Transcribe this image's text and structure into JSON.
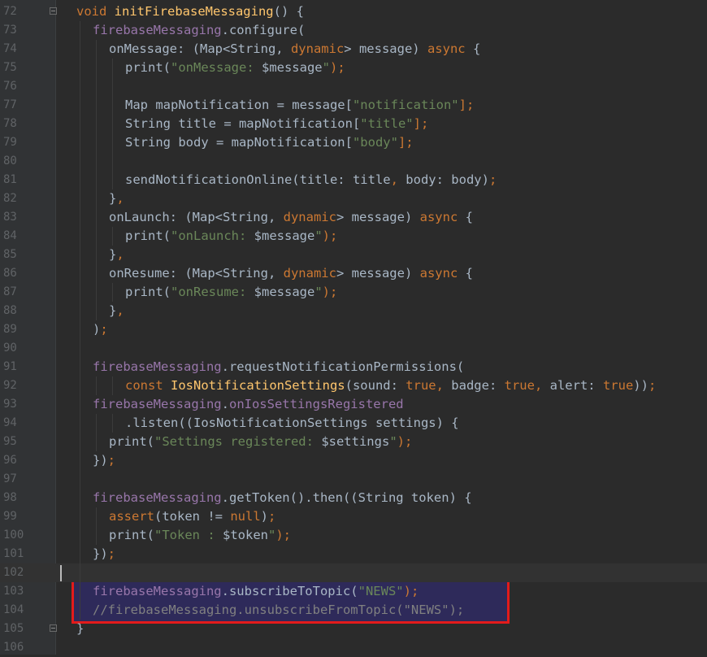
{
  "editor": {
    "lines": [
      {
        "n": "72",
        "fold": true,
        "indent": 0,
        "tokens": [
          {
            "t": "void ",
            "c": "k"
          },
          {
            "t": "initFirebaseMessaging",
            "c": "fn"
          },
          {
            "t": "() {",
            "c": "pl"
          }
        ]
      },
      {
        "n": "73",
        "indent": 1,
        "tokens": [
          {
            "t": "firebaseMessaging",
            "c": "f"
          },
          {
            "t": ".configure(",
            "c": "pl"
          }
        ]
      },
      {
        "n": "74",
        "indent": 2,
        "tokens": [
          {
            "t": "onMessage: (Map<String, ",
            "c": "pl"
          },
          {
            "t": "dynamic",
            "c": "k"
          },
          {
            "t": "> message) ",
            "c": "pl"
          },
          {
            "t": "async",
            "c": "k"
          },
          {
            "t": " {",
            "c": "pl"
          }
        ]
      },
      {
        "n": "75",
        "indent": 3,
        "tokens": [
          {
            "t": "print(",
            "c": "pl"
          },
          {
            "t": "\"onMessage: ",
            "c": "s"
          },
          {
            "t": "$message",
            "c": "pl"
          },
          {
            "t": "\"",
            "c": "s"
          },
          {
            "t": ");",
            "c": "k"
          }
        ]
      },
      {
        "n": "76",
        "indent": 3,
        "tokens": []
      },
      {
        "n": "77",
        "indent": 3,
        "tokens": [
          {
            "t": "Map mapNotification = message[",
            "c": "pl"
          },
          {
            "t": "\"notification\"",
            "c": "s"
          },
          {
            "t": "];",
            "c": "k"
          }
        ]
      },
      {
        "n": "78",
        "indent": 3,
        "tokens": [
          {
            "t": "String title = mapNotification[",
            "c": "pl"
          },
          {
            "t": "\"title\"",
            "c": "s"
          },
          {
            "t": "];",
            "c": "k"
          }
        ]
      },
      {
        "n": "79",
        "indent": 3,
        "tokens": [
          {
            "t": "String body = mapNotification[",
            "c": "pl"
          },
          {
            "t": "\"body\"",
            "c": "s"
          },
          {
            "t": "];",
            "c": "k"
          }
        ]
      },
      {
        "n": "80",
        "indent": 3,
        "tokens": []
      },
      {
        "n": "81",
        "indent": 3,
        "tokens": [
          {
            "t": "sendNotificationOnline(title: title",
            "c": "pl"
          },
          {
            "t": ", ",
            "c": "k"
          },
          {
            "t": "body: body)",
            "c": "pl"
          },
          {
            "t": ";",
            "c": "k"
          }
        ]
      },
      {
        "n": "82",
        "indent": 2,
        "tokens": [
          {
            "t": "}",
            "c": "pl"
          },
          {
            "t": ",",
            "c": "k"
          }
        ]
      },
      {
        "n": "83",
        "indent": 2,
        "tokens": [
          {
            "t": "onLaunch: (Map<String, ",
            "c": "pl"
          },
          {
            "t": "dynamic",
            "c": "k"
          },
          {
            "t": "> message) ",
            "c": "pl"
          },
          {
            "t": "async",
            "c": "k"
          },
          {
            "t": " {",
            "c": "pl"
          }
        ]
      },
      {
        "n": "84",
        "indent": 3,
        "tokens": [
          {
            "t": "print(",
            "c": "pl"
          },
          {
            "t": "\"onLaunch: ",
            "c": "s"
          },
          {
            "t": "$message",
            "c": "pl"
          },
          {
            "t": "\"",
            "c": "s"
          },
          {
            "t": ");",
            "c": "k"
          }
        ]
      },
      {
        "n": "85",
        "indent": 2,
        "tokens": [
          {
            "t": "}",
            "c": "pl"
          },
          {
            "t": ",",
            "c": "k"
          }
        ]
      },
      {
        "n": "86",
        "indent": 2,
        "tokens": [
          {
            "t": "onResume: (Map<String, ",
            "c": "pl"
          },
          {
            "t": "dynamic",
            "c": "k"
          },
          {
            "t": "> message) ",
            "c": "pl"
          },
          {
            "t": "async",
            "c": "k"
          },
          {
            "t": " {",
            "c": "pl"
          }
        ]
      },
      {
        "n": "87",
        "indent": 3,
        "tokens": [
          {
            "t": "print(",
            "c": "pl"
          },
          {
            "t": "\"onResume: ",
            "c": "s"
          },
          {
            "t": "$message",
            "c": "pl"
          },
          {
            "t": "\"",
            "c": "s"
          },
          {
            "t": ");",
            "c": "k"
          }
        ]
      },
      {
        "n": "88",
        "indent": 2,
        "tokens": [
          {
            "t": "}",
            "c": "pl"
          },
          {
            "t": ",",
            "c": "k"
          }
        ]
      },
      {
        "n": "89",
        "indent": 1,
        "tokens": [
          {
            "t": ")",
            "c": "pl"
          },
          {
            "t": ";",
            "c": "k"
          }
        ]
      },
      {
        "n": "90",
        "indent": 1,
        "tokens": []
      },
      {
        "n": "91",
        "indent": 1,
        "tokens": [
          {
            "t": "firebaseMessaging",
            "c": "f"
          },
          {
            "t": ".requestNotificationPermissions(",
            "c": "pl"
          }
        ]
      },
      {
        "n": "92",
        "indent": 3,
        "tokens": [
          {
            "t": "const ",
            "c": "k"
          },
          {
            "t": "IosNotificationSettings",
            "c": "fn"
          },
          {
            "t": "(sound: ",
            "c": "pl"
          },
          {
            "t": "true",
            "c": "k"
          },
          {
            "t": ", ",
            "c": "k"
          },
          {
            "t": "badge: ",
            "c": "pl"
          },
          {
            "t": "true",
            "c": "k"
          },
          {
            "t": ", ",
            "c": "k"
          },
          {
            "t": "alert: ",
            "c": "pl"
          },
          {
            "t": "true",
            "c": "k"
          },
          {
            "t": "))",
            "c": "pl"
          },
          {
            "t": ";",
            "c": "k"
          }
        ]
      },
      {
        "n": "93",
        "indent": 1,
        "tokens": [
          {
            "t": "firebaseMessaging",
            "c": "f"
          },
          {
            "t": ".",
            "c": "pl"
          },
          {
            "t": "onIosSettingsRegistered",
            "c": "f"
          }
        ]
      },
      {
        "n": "94",
        "indent": 3,
        "tokens": [
          {
            "t": ".listen((IosNotificationSettings settings) {",
            "c": "pl"
          }
        ]
      },
      {
        "n": "95",
        "indent": 2,
        "tokens": [
          {
            "t": "print(",
            "c": "pl"
          },
          {
            "t": "\"Settings registered: ",
            "c": "s"
          },
          {
            "t": "$settings",
            "c": "pl"
          },
          {
            "t": "\"",
            "c": "s"
          },
          {
            "t": ");",
            "c": "k"
          }
        ]
      },
      {
        "n": "96",
        "indent": 1,
        "tokens": [
          {
            "t": "})",
            "c": "pl"
          },
          {
            "t": ";",
            "c": "k"
          }
        ]
      },
      {
        "n": "97",
        "indent": 1,
        "tokens": []
      },
      {
        "n": "98",
        "indent": 1,
        "tokens": [
          {
            "t": "firebaseMessaging",
            "c": "f"
          },
          {
            "t": ".getToken().then((String token) {",
            "c": "pl"
          }
        ]
      },
      {
        "n": "99",
        "indent": 2,
        "tokens": [
          {
            "t": "assert",
            "c": "k"
          },
          {
            "t": "(token != ",
            "c": "pl"
          },
          {
            "t": "null",
            "c": "k"
          },
          {
            "t": ")",
            "c": "pl"
          },
          {
            "t": ";",
            "c": "k"
          }
        ]
      },
      {
        "n": "100",
        "indent": 2,
        "tokens": [
          {
            "t": "print(",
            "c": "pl"
          },
          {
            "t": "\"Token : ",
            "c": "s"
          },
          {
            "t": "$token",
            "c": "pl"
          },
          {
            "t": "\"",
            "c": "s"
          },
          {
            "t": ");",
            "c": "k"
          }
        ]
      },
      {
        "n": "101",
        "indent": 1,
        "tokens": [
          {
            "t": "})",
            "c": "pl"
          },
          {
            "t": ";",
            "c": "k"
          }
        ]
      },
      {
        "n": "102",
        "indent": 1,
        "current": true,
        "tokens": []
      },
      {
        "n": "103",
        "indent": 1,
        "tokens": [
          {
            "t": "firebaseMessaging",
            "c": "f"
          },
          {
            "t": ".subscribeToTopic(",
            "c": "pl"
          },
          {
            "t": "\"NEWS\"",
            "c": "s"
          },
          {
            "t": ");",
            "c": "k"
          }
        ]
      },
      {
        "n": "104",
        "indent": 1,
        "tokens": [
          {
            "t": "//firebaseMessaging.unsubscribeFromTopic(\"NEWS\");",
            "c": "cm"
          }
        ]
      },
      {
        "n": "105",
        "fold": true,
        "indent": 0,
        "tokens": [
          {
            "t": "}",
            "c": "pl"
          }
        ]
      },
      {
        "n": "106",
        "indent": 0,
        "tokens": []
      }
    ]
  }
}
